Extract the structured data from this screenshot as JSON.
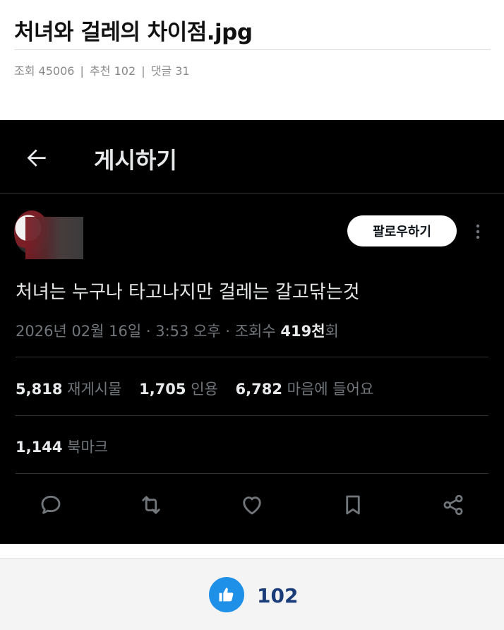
{
  "post": {
    "title": "처녀와 걸레의 차이점.jpg",
    "views_label": "조회",
    "views": "45006",
    "recommend_label": "추천",
    "recommend": "102",
    "comments_label": "댓글",
    "comments": "31",
    "separator": "|"
  },
  "tweet": {
    "nav_title": "게시하기",
    "follow_label": "팔로우하기",
    "text": "처녀는 누구나 타고나지만 걸레는 갈고닦는것",
    "timestamp": "2026년 02월 16일 · 3:53 오후 · 조회수 ",
    "views_value": "419천",
    "views_suffix": "회",
    "reposts_value": "5,818",
    "reposts_label": "재게시물",
    "quotes_value": "1,705",
    "quotes_label": "인용",
    "likes_value": "6,782",
    "likes_label": "마음에 들어요",
    "bookmarks_value": "1,144",
    "bookmarks_label": "북마크",
    "actions": [
      "reply-icon",
      "repost-icon",
      "heart-icon",
      "bookmark-icon",
      "share-icon"
    ]
  },
  "like_bar": {
    "count": "102",
    "icon": "thumbs-up-icon",
    "color": "#1e90e8"
  },
  "colors": {
    "tweet_bg": "#000000",
    "tweet_text": "#e7e9ea",
    "tweet_muted": "#71767b"
  }
}
